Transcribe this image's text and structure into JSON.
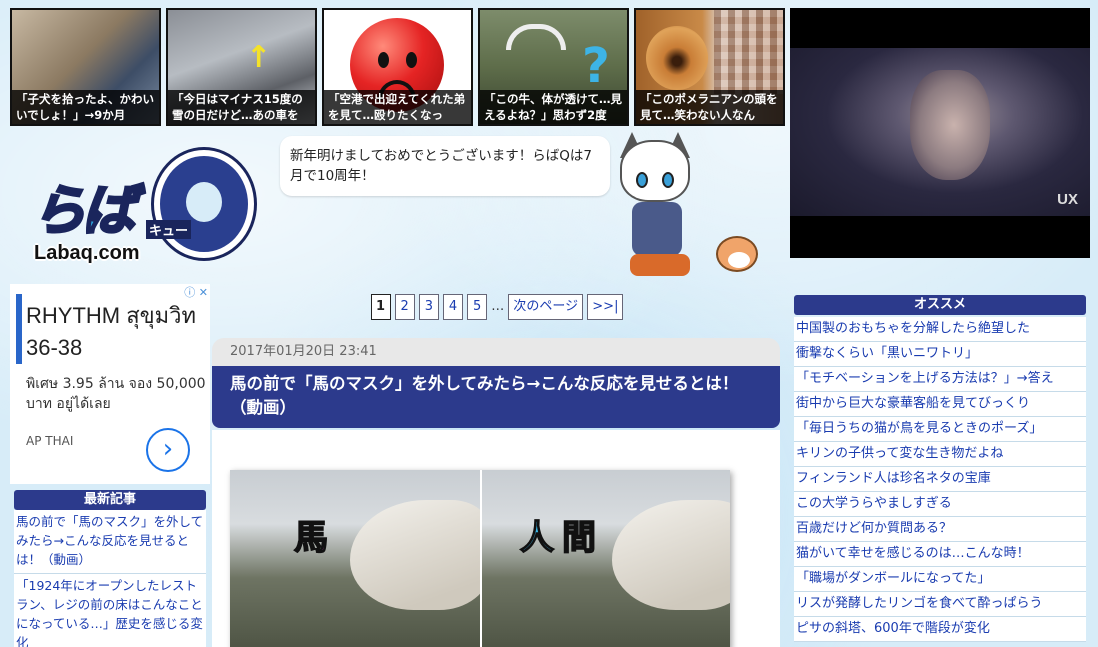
{
  "thumbnails": [
    {
      "caption": "「子犬を拾ったよ、かわいいでしょ！」→9か月"
    },
    {
      "caption": "「今日はマイナス15度の雪の日だけど…あの車を"
    },
    {
      "caption": "「空港で出迎えてくれた弟を見て…殴りたくなっ"
    },
    {
      "caption": "「この牛、体が透けて…見えるよね？」思わず2度"
    },
    {
      "caption": "「このポメラニアンの頭を見て…笑わない人なん"
    }
  ],
  "video": {
    "brand_logo": "UX"
  },
  "logo": {
    "main": "らば",
    "kyu": "キュー",
    "domain": "Labaq.com"
  },
  "bubble": {
    "text": "新年明けましておめでとうございます！らばQは7月で10周年！"
  },
  "ad": {
    "headline": "RHYTHM สุขุมวิท 36-38",
    "body": "พิเศษ 3.95 ล้าน จอง 50,000 บาท อยู่ได้เลย",
    "source": "AP THAI",
    "go_icon": "chevron-right-icon"
  },
  "latest": {
    "title": "最新記事",
    "items": [
      "馬の前で「馬のマスク」を外してみたら→こんな反応を見せるとは！（動画）",
      "「1924年にオープンしたレストラン、レジの前の床はこんなことになっている…」歴史を感じる変化"
    ]
  },
  "pager": {
    "pages": [
      "1",
      "2",
      "3",
      "4",
      "5"
    ],
    "current": "1",
    "dots": "…",
    "next": "次のページ",
    "last": ">>|"
  },
  "post": {
    "date": "2017年01月20日 23:41",
    "title": "馬の前で「馬のマスク」を外してみたら→こんな反応を見せるとは！（動画）",
    "label_left": "馬",
    "label_right": "人間"
  },
  "osusume": {
    "title": "オススメ",
    "items": [
      "中国製のおもちゃを分解したら絶望した",
      "衝撃なくらい「黒いニワトリ」",
      "「モチベーションを上げる方法は？」→答え",
      "街中から巨大な豪華客船を見てびっくり",
      "「毎日うちの猫が鳥を見るときのポーズ」",
      "キリンの子供って変な生き物だよね",
      "フィンランド人は珍名ネタの宝庫",
      "この大学うらやましすぎる",
      "百歳だけど何か質問ある？",
      "猫がいて幸せを感じるのは…こんな時！",
      "「職場がダンボールになってた」",
      "リスが発酵したリンゴを食べて酔っぱらう",
      "ピサの斜塔、600年で階段が変化"
    ]
  },
  "colors": {
    "header_navy": "#2c3a8c",
    "link_blue": "#1a3cb0",
    "bg_sky": "#d7ecf8"
  }
}
